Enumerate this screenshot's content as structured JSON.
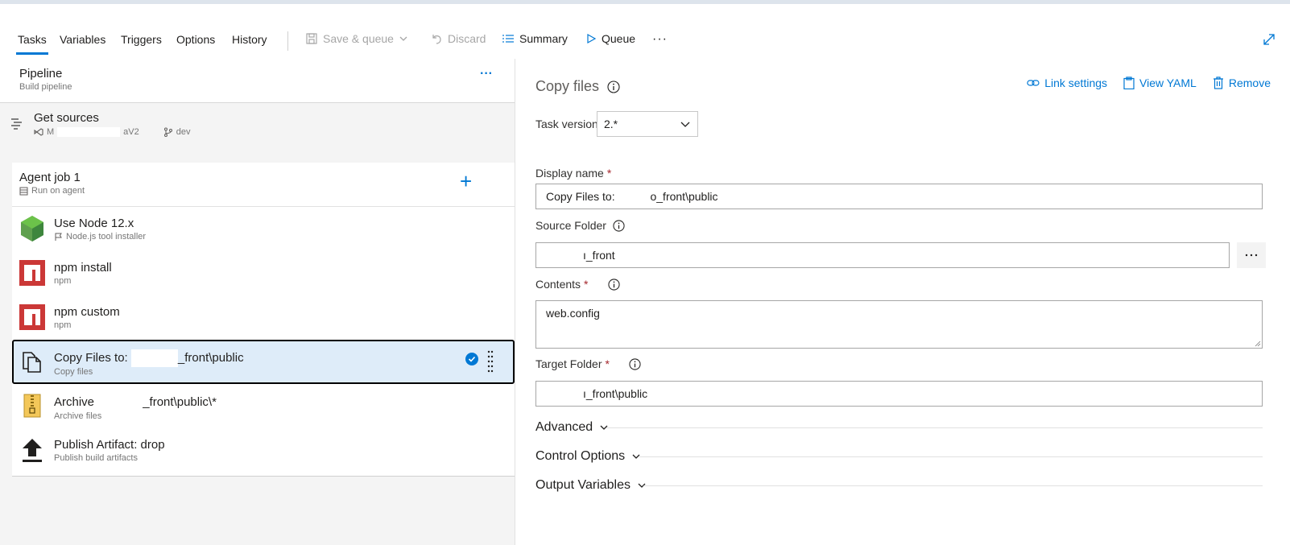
{
  "toolbar": {
    "tabs": [
      "Tasks",
      "Variables",
      "Triggers",
      "Options",
      "History"
    ],
    "save_queue": "Save & queue",
    "discard": "Discard",
    "summary": "Summary",
    "queue": "Queue",
    "more": "···"
  },
  "pipeline": {
    "title": "Pipeline",
    "subtitle": "Build pipeline",
    "more": "···"
  },
  "sources": {
    "title": "Get sources",
    "repo_start": "M",
    "repo_end": "aV2",
    "branch": "dev"
  },
  "agent_job": {
    "title": "Agent job 1",
    "subtitle": "Run on agent",
    "add": "+"
  },
  "tasks": [
    {
      "title": "Use Node 12.x",
      "subtitle": "Node.js tool installer"
    },
    {
      "title": "npm install",
      "subtitle": "npm"
    },
    {
      "title": "npm custom",
      "subtitle": "npm"
    },
    {
      "title_prefix": "Copy Files to:",
      "title_suffix": "_front\\public",
      "subtitle": "Copy files"
    },
    {
      "title_prefix": "Archive",
      "title_suffix": "_front\\public\\*",
      "subtitle": "Archive files"
    },
    {
      "title": "Publish Artifact: drop",
      "subtitle": "Publish build artifacts"
    }
  ],
  "details": {
    "title": "Copy files",
    "link_settings": "Link settings",
    "view_yaml": "View YAML",
    "remove": "Remove",
    "task_version_label": "Task version",
    "task_version_value": "2.*",
    "display_name_label": "Display name",
    "display_name_prefix": "Copy Files to:",
    "display_name_suffix": "o_front\\public",
    "source_folder_label": "Source Folder",
    "source_folder_value": "ı_front",
    "contents_label": "Contents",
    "contents_value": "web.config",
    "target_folder_label": "Target Folder",
    "target_folder_value": "ı_front\\public",
    "required": "*",
    "sections": [
      "Advanced",
      "Control Options",
      "Output Variables"
    ]
  },
  "colors": {
    "accent": "#0078d4",
    "selected_bg": "#deecf9",
    "npm_red": "#cb3837",
    "node_green": "#5fa04e"
  }
}
